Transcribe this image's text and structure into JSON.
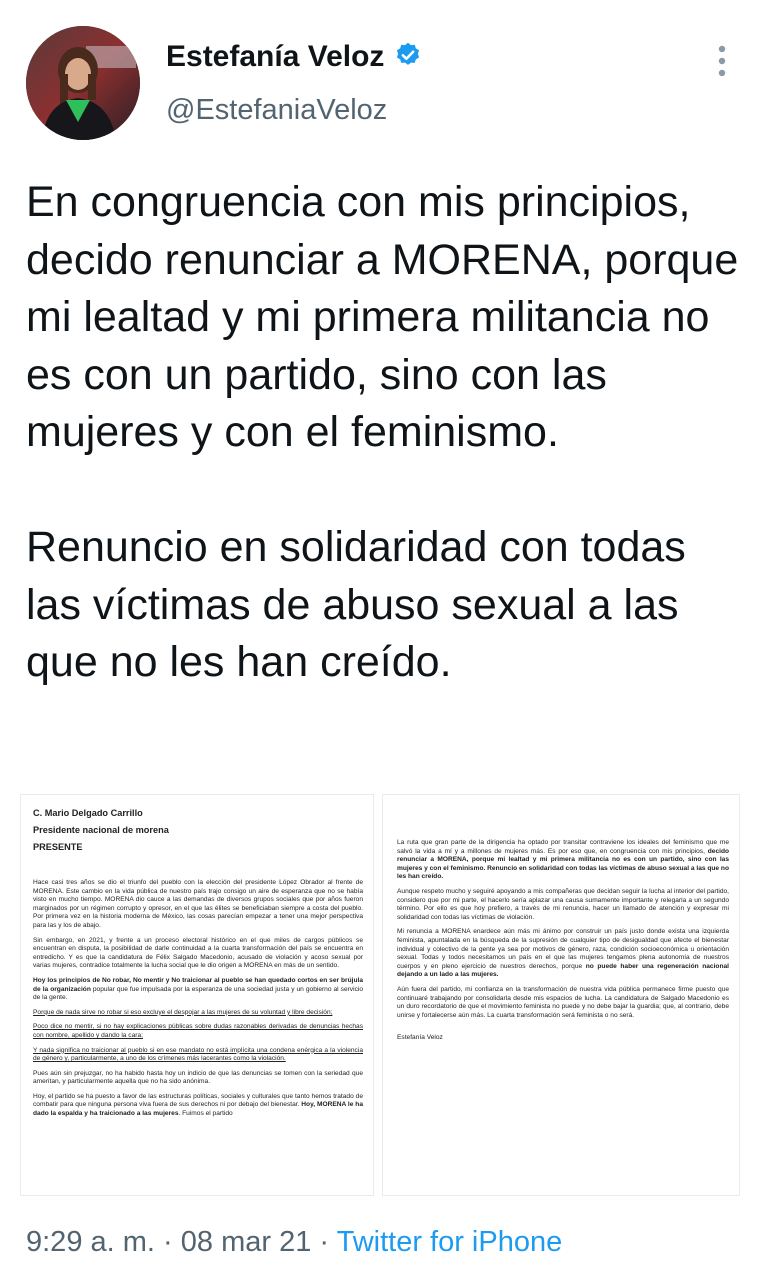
{
  "author": {
    "name": "Estefanía Veloz",
    "handle": "@EstefaniaVeloz",
    "verified": true
  },
  "icons": {
    "verified": "verified-badge-icon",
    "more": "more-vertical-icon"
  },
  "colors": {
    "verified_blue": "#1d9bf0",
    "link_blue": "#1d9bf0",
    "muted_gray": "#536471",
    "text": "#0f1419"
  },
  "tweet": {
    "text": "En congruencia con mis principios, decido renunciar a MORENA, porque mi lealtad y mi primera militancia no es con un partido, sino con las mujeres y con el feminismo.\n\nRenuncio en solidaridad con todas las víctimas de abuso sexual a las que no les han creído."
  },
  "letter_page1": {
    "addressee": "C. Mario Delgado Carrillo",
    "position": "Presidente nacional de morena",
    "presente": "PRESENTE",
    "p1": "Hace casi tres años se dio el triunfo del pueblo con la elección del presidente López Obrador al frente de MORENA. Este cambio en la vida pública de nuestro país trajo consigo un aire de esperanza que no se había visto en mucho tiempo. MORENA dio cauce a las demandas de diversos grupos sociales que por años fueron marginados por un régimen corrupto y opresor, en el que las élites se beneficiaban siempre a costa del pueblo. Por primera vez en la historia moderna de México, las cosas parecían empezar a tener una mejor perspectiva para las y los de abajo.",
    "p2": "Sin embargo, en 2021, y frente a un proceso electoral histórico en el que miles de cargos públicos se encuentran en disputa, la posibilidad de darle continuidad a la cuarta transformación del país se encuentra en entredicho. Y es que la candidatura de Félix Salgado Macedonio, acusado de violación y acoso sexual por varias mujeres, contradice totalmente la lucha social que le dio origen a MORENA en más de un sentido.",
    "p3_bold": "Hoy los principios de No robar, No mentir y No traicionar al pueblo se han quedado cortos en ser brújula de la organización",
    "p3_rest": " popular que fue impulsada por la esperanza de una sociedad justa y un gobierno al servicio de la gente.",
    "p4": "Porque de nada sirve no robar si eso excluye el despojar a las mujeres de su voluntad y libre decisión;",
    "p5": "Poco dice no mentir, si no hay explicaciones públicas sobre dudas razonables derivadas de denuncias hechas con nombre, apellido y dando la cara;",
    "p6": "Y nada significa no traicionar al pueblo si en ese mandato no está implícita una condena enérgica a la violencia de género y, particularmente, a uno de los crímenes más lacerantes como la violación.",
    "p7": "Pues aún sin prejuzgar, no ha habido hasta hoy un indicio de que las denuncias se tomen con la seriedad que ameritan, y particularmente aquella que no ha sido anónima.",
    "p8_start": "Hoy, el partido se ha puesto a favor de las estructuras políticas, sociales y culturales que tanto hemos tratado de combatir para que ninguna persona viva fuera de sus derechos ni por debajo del bienestar. ",
    "p8_bold": "Hoy, MORENA le ha dado la espalda y ha traicionado a las mujeres",
    "p8_end": ". Fuimos el partido"
  },
  "letter_page2": {
    "p1_start": "La ruta que gran parte de la dirigencia ha optado por transitar contraviene los ideales del feminismo que me salvó la vida a mí y a millones de mujeres más. Es por eso que, en congruencia con mis principios, ",
    "p1_bold1": "decido renunciar a MORENA, porque mi lealtad y mi primera militancia no es con un partido, sino con las mujeres y con el feminismo. Renuncio en solidaridad con todas las víctimas de abuso sexual a las que no les han creído.",
    "p2": "Aunque respeto mucho y seguiré apoyando a mis compañeras que decidan seguir la lucha al interior del partido, considero que por mi parte, el hacerlo sería aplazar una causa sumamente importante y relegarla a un segundo término. Por ello es que hoy prefiero, a través de mi renuncia, hacer un llamado de atención y expresar mi solidaridad con todas las víctimas de violación.",
    "p3_start": "Mi renuncia a MORENA enardece aún más mi ánimo por construir un país justo donde exista una izquierda feminista, apuntalada en la búsqueda de la supresión de cualquier tipo de desigualdad que afecte el bienestar individual y colectivo de la gente ya sea por motivos de género, raza, condición socioeconómica u orientación sexual. Todas y todos necesitamos un país en el que las mujeres tengamos plena autonomía de nuestros cuerpos y en pleno ejercicio de nuestros derechos, porque ",
    "p3_bold": "no puede haber una regeneración nacional dejando a un lado a las mujeres.",
    "p4": "Aún fuera del partido, mi confianza en la transformación de nuestra vida pública permanece firme puesto que continuaré trabajando por consolidarla desde mis espacios de lucha. La candidatura de Salgado Macedonio es un duro recordatorio de que el movimiento feminista no puede y no debe bajar la guardia; que, al contrario, debe unirse y fortalecerse aún más. La cuarta transformación será feminista o no será.",
    "signature": "Estefanía Veloz"
  },
  "meta": {
    "time": "9:29 a. m.",
    "sep1": " · ",
    "date": "08 mar 21",
    "sep2": " · ",
    "source": "Twitter for iPhone"
  }
}
